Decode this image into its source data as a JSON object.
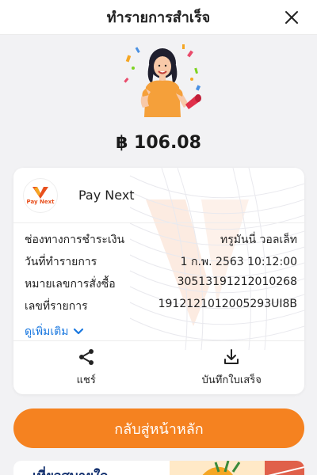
{
  "header": {
    "title": "ทำรายการสำเร็จ",
    "close_icon": "close-icon"
  },
  "amount": "฿ 106.08",
  "card": {
    "merchant": {
      "name": "Pay Next",
      "logo_text": "Pay Next"
    },
    "details": [
      {
        "label": "ช่องทางการชำระเงิน",
        "value": "ทรูมันนี่ วอลเล็ท"
      },
      {
        "label": "วันที่ทำรายการ",
        "value": "1 ก.พ. 2563 10:12:00"
      },
      {
        "label": "หมายเลขการสั่งซื้อ",
        "value": "30513191212010268"
      },
      {
        "label": "เลขที่รายการ",
        "value": "191212101200529​3UI8B"
      }
    ],
    "more_label": "ดูเพิ่มเติม",
    "actions": {
      "share_label": "แชร์",
      "save_label": "บันทึกใบเสร็จ"
    }
  },
  "home_button": "กลับสู่หน้าหลัก",
  "promo": {
    "text": "เที่ยวสบายใจ"
  },
  "colors": {
    "accent": "#f58220",
    "link": "#1a78e0",
    "promo_text": "#0d2b6b"
  }
}
